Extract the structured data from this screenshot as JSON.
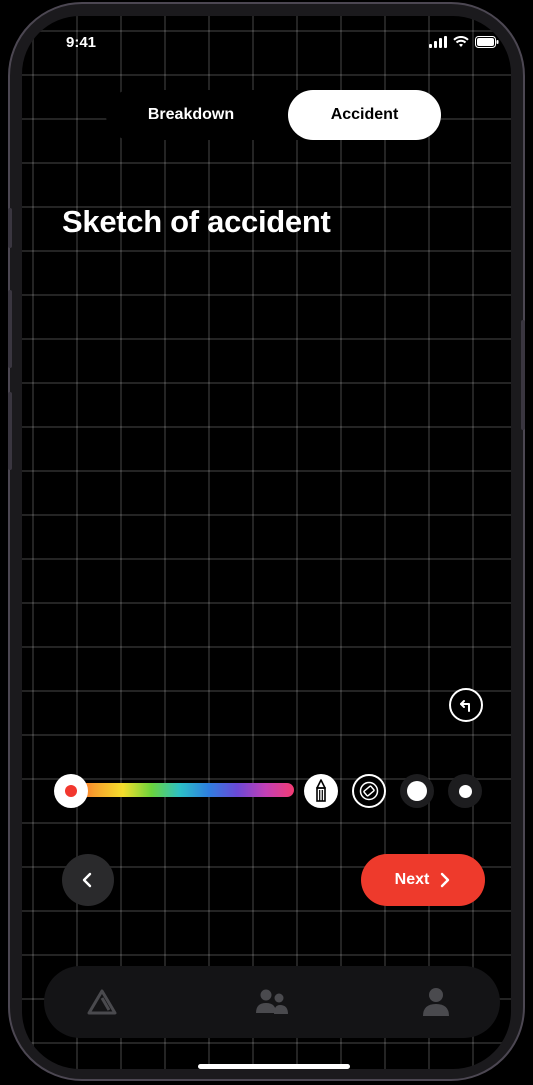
{
  "status_bar": {
    "time": "9:41"
  },
  "segmented": {
    "options": [
      "Breakdown",
      "Accident"
    ],
    "selected": "Accident"
  },
  "page": {
    "title": "Sketch of accident"
  },
  "drawing_tools": {
    "selected_color": "#f2372e",
    "selected_tool": "pencil",
    "tools": [
      "pencil-icon",
      "eraser-icon",
      "brush-size-large",
      "brush-size-small"
    ]
  },
  "nav": {
    "next_label": "Next"
  },
  "tabbar": {
    "items": [
      "home-icon",
      "people-icon",
      "profile-icon"
    ]
  },
  "colors": {
    "accent": "#ee3a2c",
    "background": "#000000",
    "grid": "#3a3a3a"
  }
}
